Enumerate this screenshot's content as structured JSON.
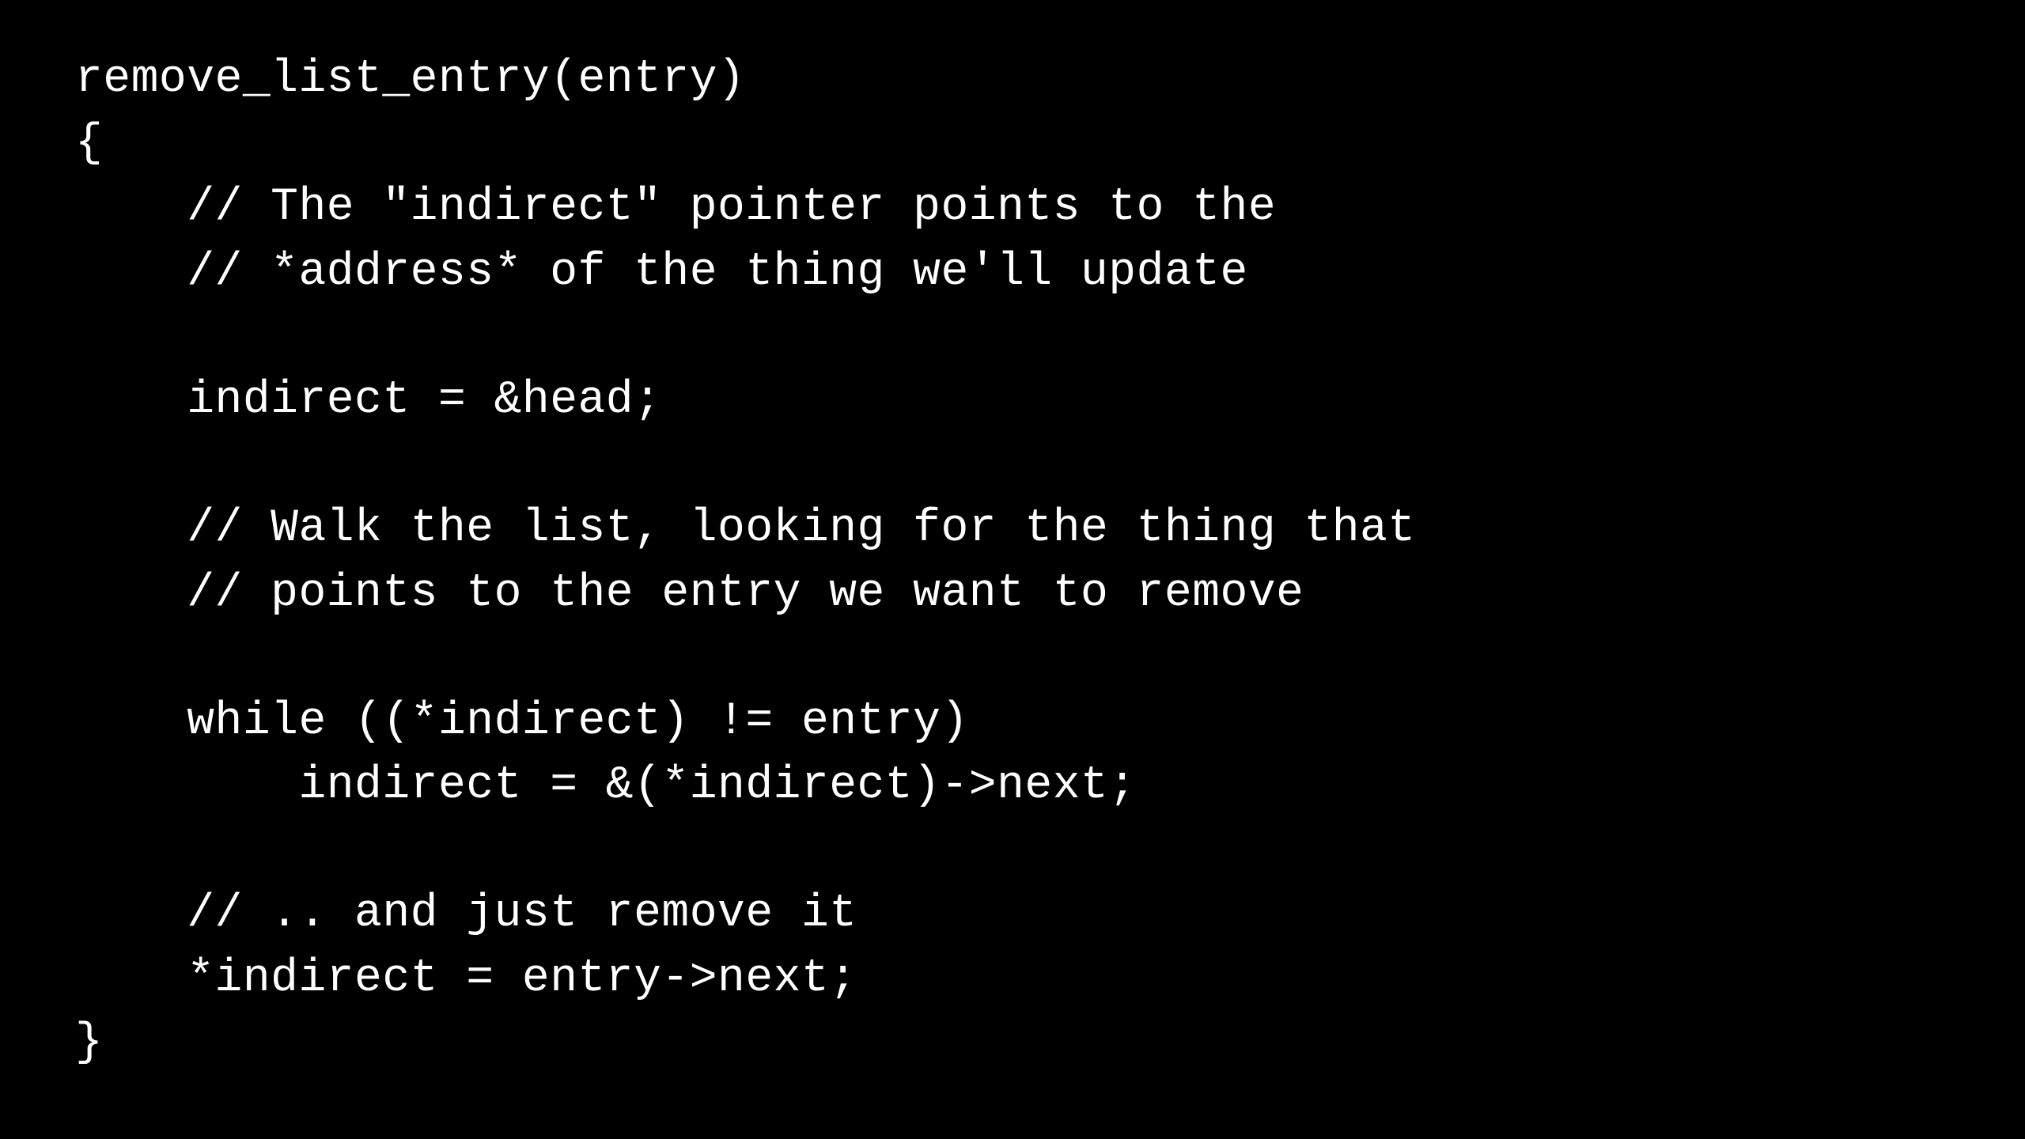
{
  "code": {
    "lines": [
      "remove_list_entry(entry)",
      "{",
      "    // The \"indirect\" pointer points to the",
      "    // *address* of the thing we'll update",
      "",
      "    indirect = &head;",
      "",
      "    // Walk the list, looking for the thing that",
      "    // points to the entry we want to remove",
      "",
      "    while ((*indirect) != entry)",
      "        indirect = &(*indirect)->next;",
      "",
      "    // .. and just remove it",
      "    *indirect = entry->next;",
      "}"
    ]
  }
}
